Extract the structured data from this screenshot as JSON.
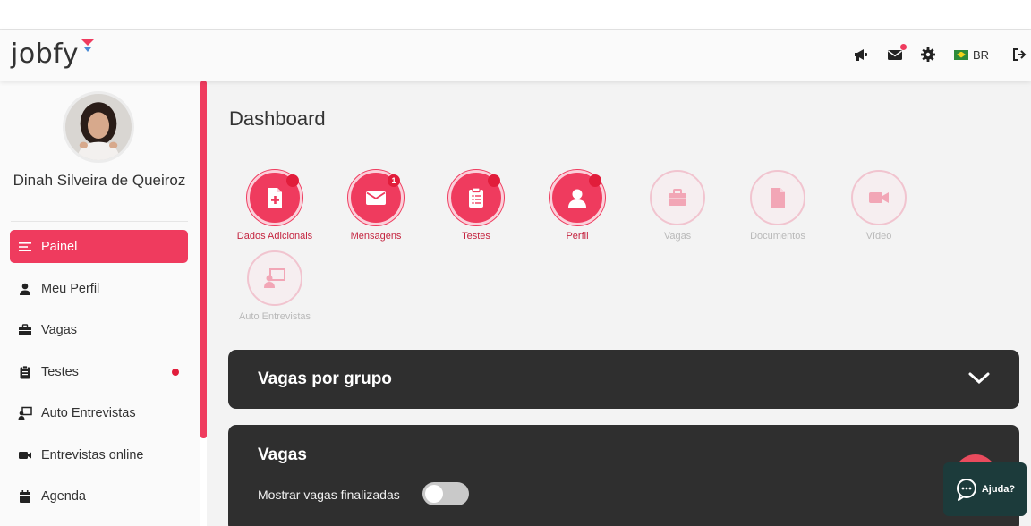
{
  "brand": {
    "logo_text": "jobfy",
    "accent": "#ef3b5e",
    "dark_panel": "#2f2f2f"
  },
  "header": {
    "icons": [
      "megaphone-icon",
      "mail-icon",
      "gear-icon",
      "flag-icon",
      "logout-icon"
    ],
    "language": "BR"
  },
  "sidebar": {
    "user_name": "Dinah Silveira de Queiroz",
    "items": [
      {
        "label": "Painel",
        "icon": "bars-icon",
        "active": true
      },
      {
        "label": "Meu Perfil",
        "icon": "user-icon"
      },
      {
        "label": "Vagas",
        "icon": "briefcase-icon"
      },
      {
        "label": "Testes",
        "icon": "clipboard-icon",
        "badge": "dot"
      },
      {
        "label": "Auto Entrevistas",
        "icon": "presentation-icon"
      },
      {
        "label": "Entrevistas online",
        "icon": "video-icon"
      },
      {
        "label": "Agenda",
        "icon": "calendar-icon"
      }
    ]
  },
  "main": {
    "title": "Dashboard",
    "shortcuts": [
      {
        "label": "Dados Adicionais",
        "icon": "file-plus-icon",
        "enabled": true,
        "badge": "dot"
      },
      {
        "label": "Mensagens",
        "icon": "envelope-icon",
        "enabled": true,
        "badge": "1"
      },
      {
        "label": "Testes",
        "icon": "clipboard-icon",
        "enabled": true,
        "badge": "dot"
      },
      {
        "label": "Perfil",
        "icon": "user-icon",
        "enabled": true,
        "badge": "dot"
      },
      {
        "label": "Vagas",
        "icon": "briefcase-icon",
        "enabled": false
      },
      {
        "label": "Documentos",
        "icon": "document-icon",
        "enabled": false
      },
      {
        "label": "Vídeo",
        "icon": "video-icon",
        "enabled": false
      },
      {
        "label": "Auto Entrevistas",
        "icon": "presentation-icon",
        "enabled": false
      }
    ],
    "panels": {
      "vagas_por_grupo": {
        "title": "Vagas por grupo"
      },
      "vagas": {
        "title": "Vagas",
        "toggle_label": "Mostrar vagas finalizadas",
        "toggle_on": false
      }
    }
  },
  "help": {
    "label": "Ajuda?"
  }
}
